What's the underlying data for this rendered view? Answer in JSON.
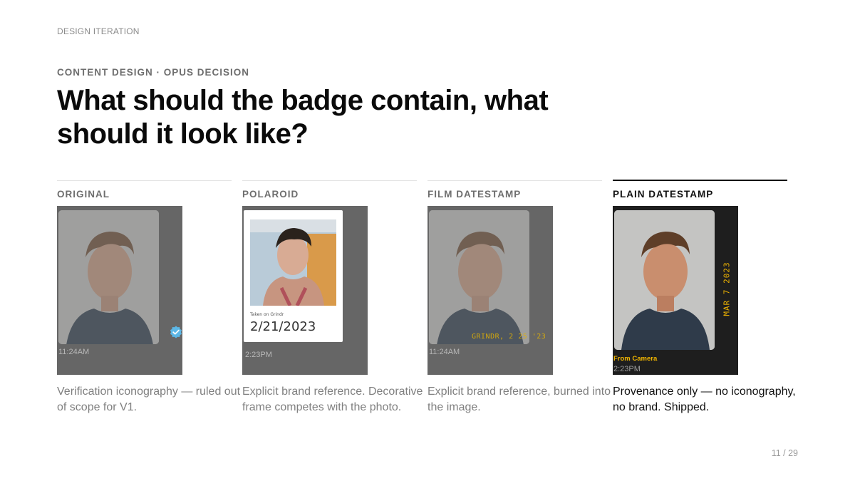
{
  "section_label": "DESIGN ITERATION",
  "eyebrow": "CONTENT DESIGN · OPUS DECISION",
  "headline": "What should the badge contain, what should it look like?",
  "options": [
    {
      "title": "ORIGINAL",
      "time": "11:24AM",
      "caption": "Verification iconography — ruled out of scope for V1.",
      "icon": "verified-check-icon",
      "accent": "#5cb7e6"
    },
    {
      "title": "POLAROID",
      "time": "2:23PM",
      "frame_small_text": "Taken on Grindr",
      "frame_date": "2/21/2023",
      "caption": "Explicit brand reference. Decorative frame competes with the photo."
    },
    {
      "title": "FILM DATESTAMP",
      "time": "11:24AM",
      "burned_stamp": "GRINDR, 2 25 '23",
      "caption": "Explicit brand reference, burned into the image."
    },
    {
      "title": "PLAIN DATESTAMP",
      "time": "2:23PM",
      "vertical_stamp": "MAR 7 2023",
      "source_label": "From Camera",
      "caption": "Provenance only — no iconography, no brand. Shipped.",
      "stamp_color": "#f2b600"
    }
  ],
  "page_indicator": "11 / 29"
}
